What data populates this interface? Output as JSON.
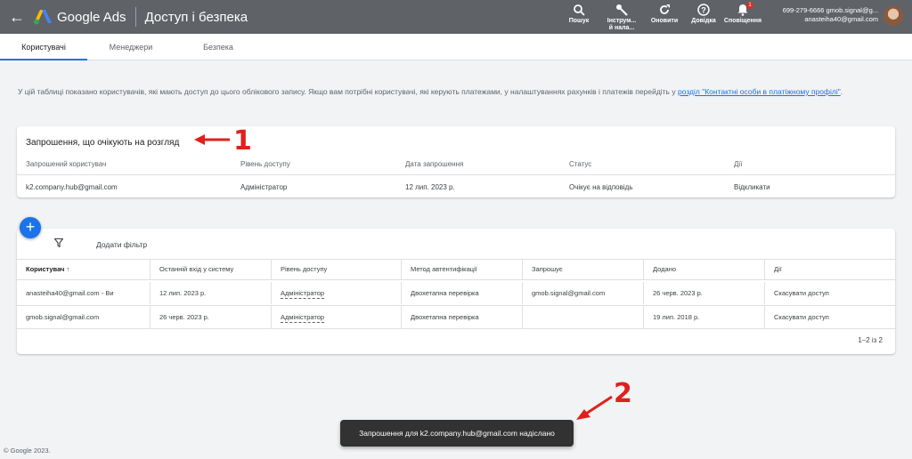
{
  "header": {
    "back_icon": "arrow-back-icon",
    "brand": "Google Ads",
    "title": "Доступ і безпека",
    "tools": [
      {
        "icon": "search-icon",
        "label": "Пошук",
        "label2": ""
      },
      {
        "icon": "wrench-icon",
        "label": "Інструм...",
        "label2": "й нала..."
      },
      {
        "icon": "refresh-icon",
        "label": "Оновити",
        "label2": ""
      },
      {
        "icon": "help-icon",
        "label": "Довідка",
        "label2": ""
      },
      {
        "icon": "bell-icon",
        "label": "Сповіщення",
        "label2": "",
        "badge": "1"
      }
    ],
    "account_line1": "699-279-6666 gmob.signal@g...",
    "account_line2": "anasteiha40@gmail.com"
  },
  "tabs": [
    {
      "label": "Користувачі",
      "active": true
    },
    {
      "label": "Менеджери",
      "active": false
    },
    {
      "label": "Безпека",
      "active": false
    }
  ],
  "intro": {
    "text": "У цій таблиці показано користувачів, які мають доступ до цього облікового запису. Якщо вам потрібні користувачі, які керують платежами, у налаштуваннях рахунків і платежів перейдіть у ",
    "link": "розділ \"Контактні особи в платіжному профілі\"",
    "after": "."
  },
  "pending": {
    "title": "Запрошення, що очікують на розгляд",
    "columns": [
      "Запрошений користувач",
      "Рівень доступу",
      "Дата запрошення",
      "Статус",
      "Дії"
    ],
    "row": {
      "user": "k2.company.hub@gmail.com",
      "access": "Адміністратор",
      "date": "12 лип. 2023 р.",
      "status": "Очікує на відповідь",
      "action": "Відкликати"
    }
  },
  "fab_icon": "plus-icon",
  "users": {
    "filter_icon": "filter-icon",
    "filter_label": "Додати фільтр",
    "columns": [
      "Користувач",
      "Останній вхід у систему",
      "Рівень доступу",
      "Метод автентифікації",
      "Запрошує",
      "Додано",
      "Дії"
    ],
    "sort_icon": "arrow-up-icon",
    "rows": [
      [
        "anasteiha40@gmail.com - Ви",
        "12 лип. 2023 р.",
        "Адміністратор",
        "Двохетапна перевірка",
        "gmob.signal@gmail.com",
        "26 черв. 2023 р.",
        "Скасувати доступ"
      ],
      [
        "gmob.signal@gmail.com",
        "26 черв. 2023 р.",
        "Адміністратор",
        "Двохетапна перевірка",
        "",
        "19 лип. 2018 р.",
        "Скасувати доступ"
      ]
    ],
    "pager": "1–2 із 2"
  },
  "footer": "© Google 2023.",
  "toast": "Запрошення для k2.company.hub@gmail.com надіслано",
  "annotations": {
    "first": "1",
    "second": "2",
    "color": "#e0201c"
  }
}
